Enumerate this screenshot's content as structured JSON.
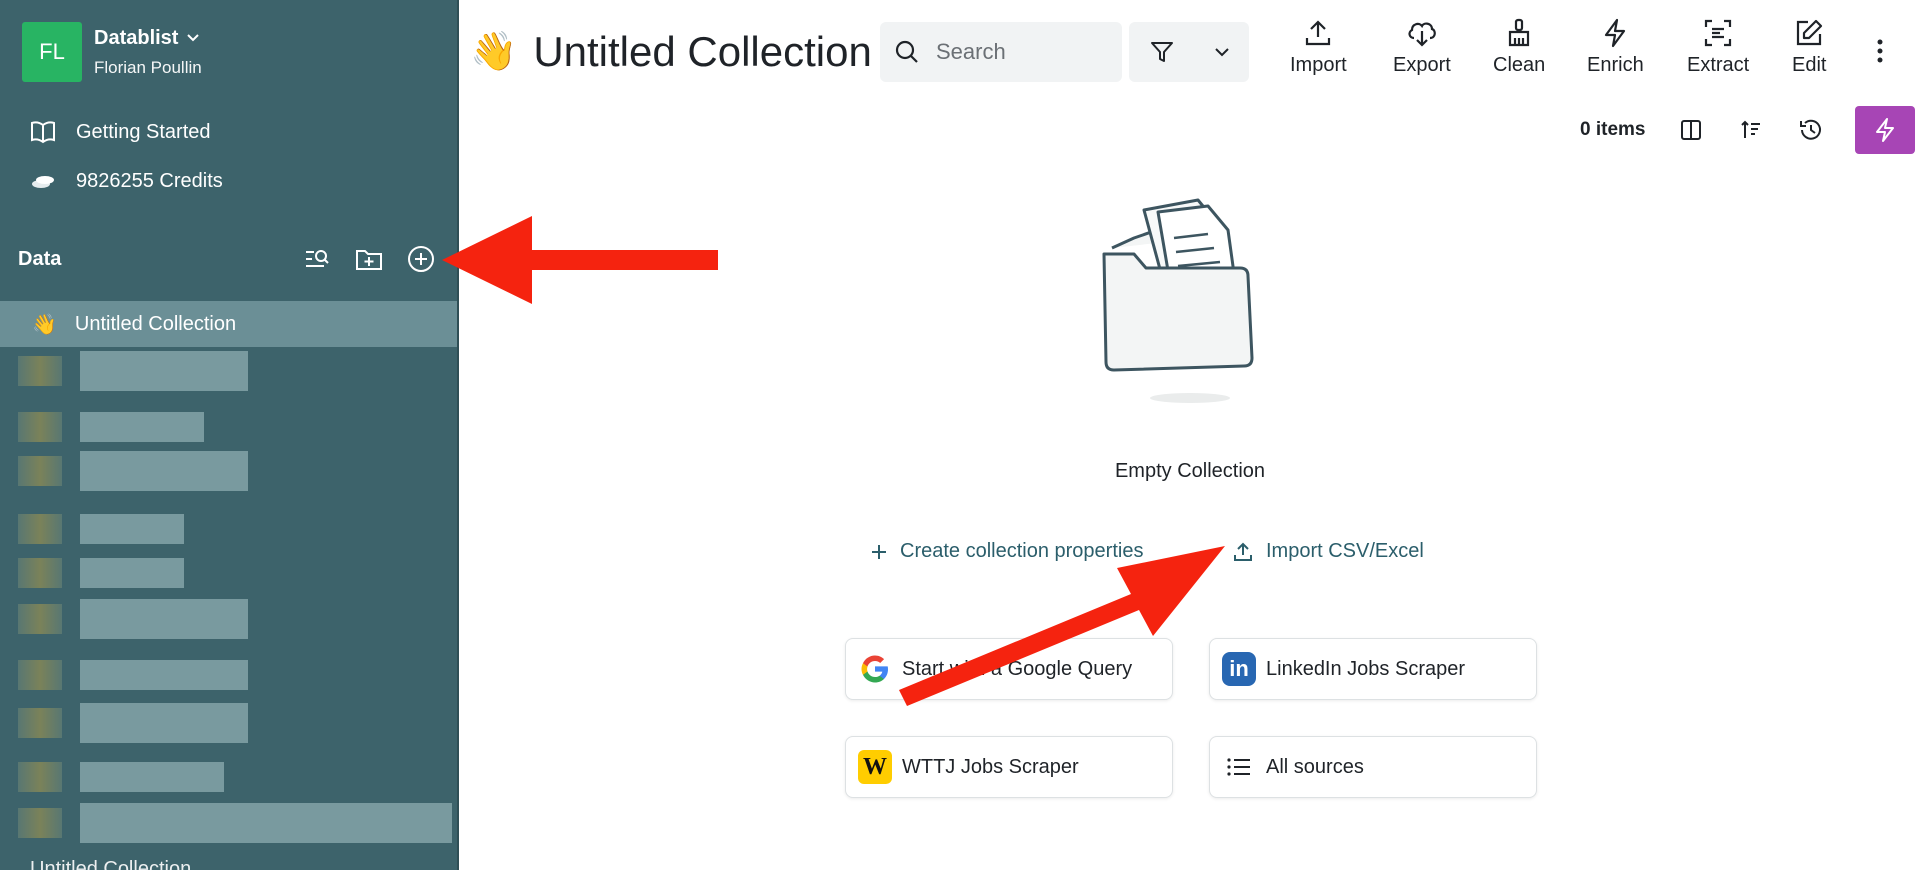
{
  "workspace": {
    "initials": "FL",
    "name": "Datablist",
    "user": "Florian Poullin"
  },
  "sidebar": {
    "getting_started": "Getting Started",
    "credits": "9826255 Credits",
    "data_heading": "Data",
    "active_collection": {
      "emoji": "👋",
      "label": "Untitled Collection"
    },
    "bottom_item": "Untitled Collection"
  },
  "header": {
    "title": "Untitled Collection",
    "emoji": "👋",
    "search_placeholder": "Search",
    "toolbar": [
      "Import",
      "Export",
      "Clean",
      "Enrich",
      "Extract",
      "Edit"
    ]
  },
  "subbar": {
    "items_count": "0 items"
  },
  "empty_state": {
    "label": "Empty Collection",
    "create_properties": "Create collection properties",
    "import_csv": "Import CSV/Excel"
  },
  "sources": [
    {
      "label": "Start with a Google Query",
      "icon": "google-icon"
    },
    {
      "label": "LinkedIn Jobs Scraper",
      "icon": "linkedin-icon"
    },
    {
      "label": "WTTJ Jobs Scraper",
      "icon": "wttj-icon"
    },
    {
      "label": "All sources",
      "icon": "list-icon"
    }
  ],
  "colors": {
    "sidebar": "#3d636b",
    "active_item": "#6b8f96",
    "accent_purple": "#a745b5",
    "annotation_arrow": "#f5230f",
    "link": "#2b5e6b"
  }
}
